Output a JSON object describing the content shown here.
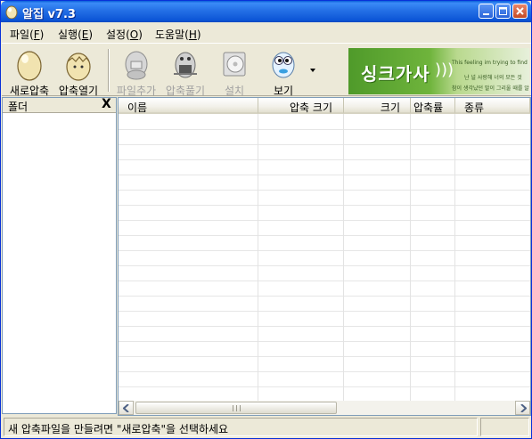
{
  "window": {
    "title": "알집 v7.3",
    "controls": {
      "minimize": "minimize",
      "maximize": "maximize",
      "close": "close"
    }
  },
  "menu": [
    {
      "label": "파일(",
      "key": "F",
      "suffix": ")"
    },
    {
      "label": "실행(",
      "key": "E",
      "suffix": ")"
    },
    {
      "label": "설정(",
      "key": "O",
      "suffix": ")"
    },
    {
      "label": "도움말(",
      "key": "H",
      "suffix": ")"
    }
  ],
  "toolbar": {
    "new_archive": "새로압축",
    "open_archive": "압축열기",
    "add_files": "파일추가",
    "extract": "압축풀기",
    "install": "설치",
    "view": "보기"
  },
  "banner": {
    "title": "싱크가사",
    "line1": "This feeling  im trying to find",
    "line2": "난 널 사랑해 너의 모든 것",
    "line3": "참이 생각났던 말이 그리울 때를 알아"
  },
  "folder_pane": {
    "title": "폴더",
    "close": "X"
  },
  "file_list": {
    "columns": [
      "이름",
      "압축 크기",
      "크기",
      "압축률",
      "종류"
    ]
  },
  "status": {
    "message": "새 압축파일을 만들려면 \"새로압축\"을 선택하세요"
  },
  "colors": {
    "title_bar": "#0a5fd8",
    "banner_green": "#4f9a2a",
    "window_bg": "#ece9d8"
  }
}
